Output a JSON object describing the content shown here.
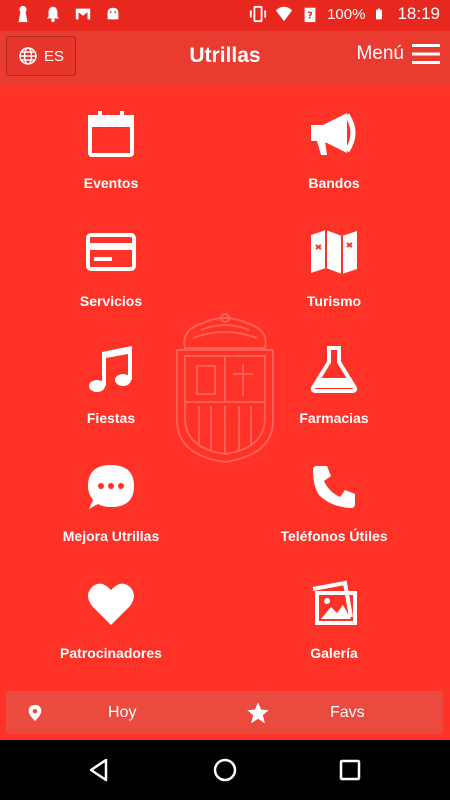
{
  "status_bar": {
    "battery": "100%",
    "time": "18:19",
    "left_icons": [
      "keyhole-icon",
      "bell-icon",
      "gmail-icon",
      "android-icon"
    ],
    "right_icons": [
      "vibrate-icon",
      "wifi-icon",
      "signal-question-icon",
      "battery-icon"
    ]
  },
  "app_bar": {
    "title": "Utrillas",
    "language": "ES",
    "menu_label": "Menú",
    "background": "#ea3b30"
  },
  "main": {
    "background": "#ff3227",
    "watermark": "town-crest",
    "tiles": [
      {
        "label": "Eventos",
        "icon": "calendar-icon"
      },
      {
        "label": "Bandos",
        "icon": "megaphone-icon"
      },
      {
        "label": "Servicios",
        "icon": "credit-card-icon"
      },
      {
        "label": "Turismo",
        "icon": "map-icon"
      },
      {
        "label": "Fiestas",
        "icon": "music-note-icon"
      },
      {
        "label": "Farmacias",
        "icon": "flask-icon"
      },
      {
        "label": "Mejora Utrillas",
        "icon": "chat-bubble-icon"
      },
      {
        "label": "Teléfonos Útiles",
        "icon": "phone-icon"
      },
      {
        "label": "Patrocinadores",
        "icon": "heart-icon"
      },
      {
        "label": "Galería",
        "icon": "gallery-icon"
      }
    ]
  },
  "bottom_bar": {
    "hoy_label": "Hoy",
    "favs_label": "Favs"
  },
  "nav_bar": {
    "buttons": [
      "back-icon",
      "home-icon",
      "recents-icon"
    ]
  }
}
